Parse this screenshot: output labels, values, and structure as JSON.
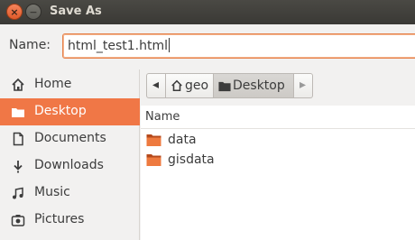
{
  "window": {
    "title": "Save As",
    "close_symbol": "×",
    "min_symbol": "−"
  },
  "name_row": {
    "label": "Name:",
    "value": "html_test1.html"
  },
  "sidebar": {
    "items": [
      {
        "label": "Home",
        "icon": "home-icon"
      },
      {
        "label": "Desktop",
        "icon": "folder-icon",
        "active": true
      },
      {
        "label": "Documents",
        "icon": "document-icon"
      },
      {
        "label": "Downloads",
        "icon": "download-icon"
      },
      {
        "label": "Music",
        "icon": "music-icon"
      },
      {
        "label": "Pictures",
        "icon": "pictures-icon"
      }
    ]
  },
  "pathbar": {
    "left_arrow": "◂",
    "right_arrow": "▸",
    "segments": [
      "geo",
      "Desktop"
    ]
  },
  "file_list": {
    "column_header": "Name",
    "rows": [
      {
        "name": "data"
      },
      {
        "name": "gisdata"
      }
    ]
  },
  "colors": {
    "accent": "#f07746",
    "titlebar": "#3c3b37",
    "folder": "#e9773c"
  }
}
